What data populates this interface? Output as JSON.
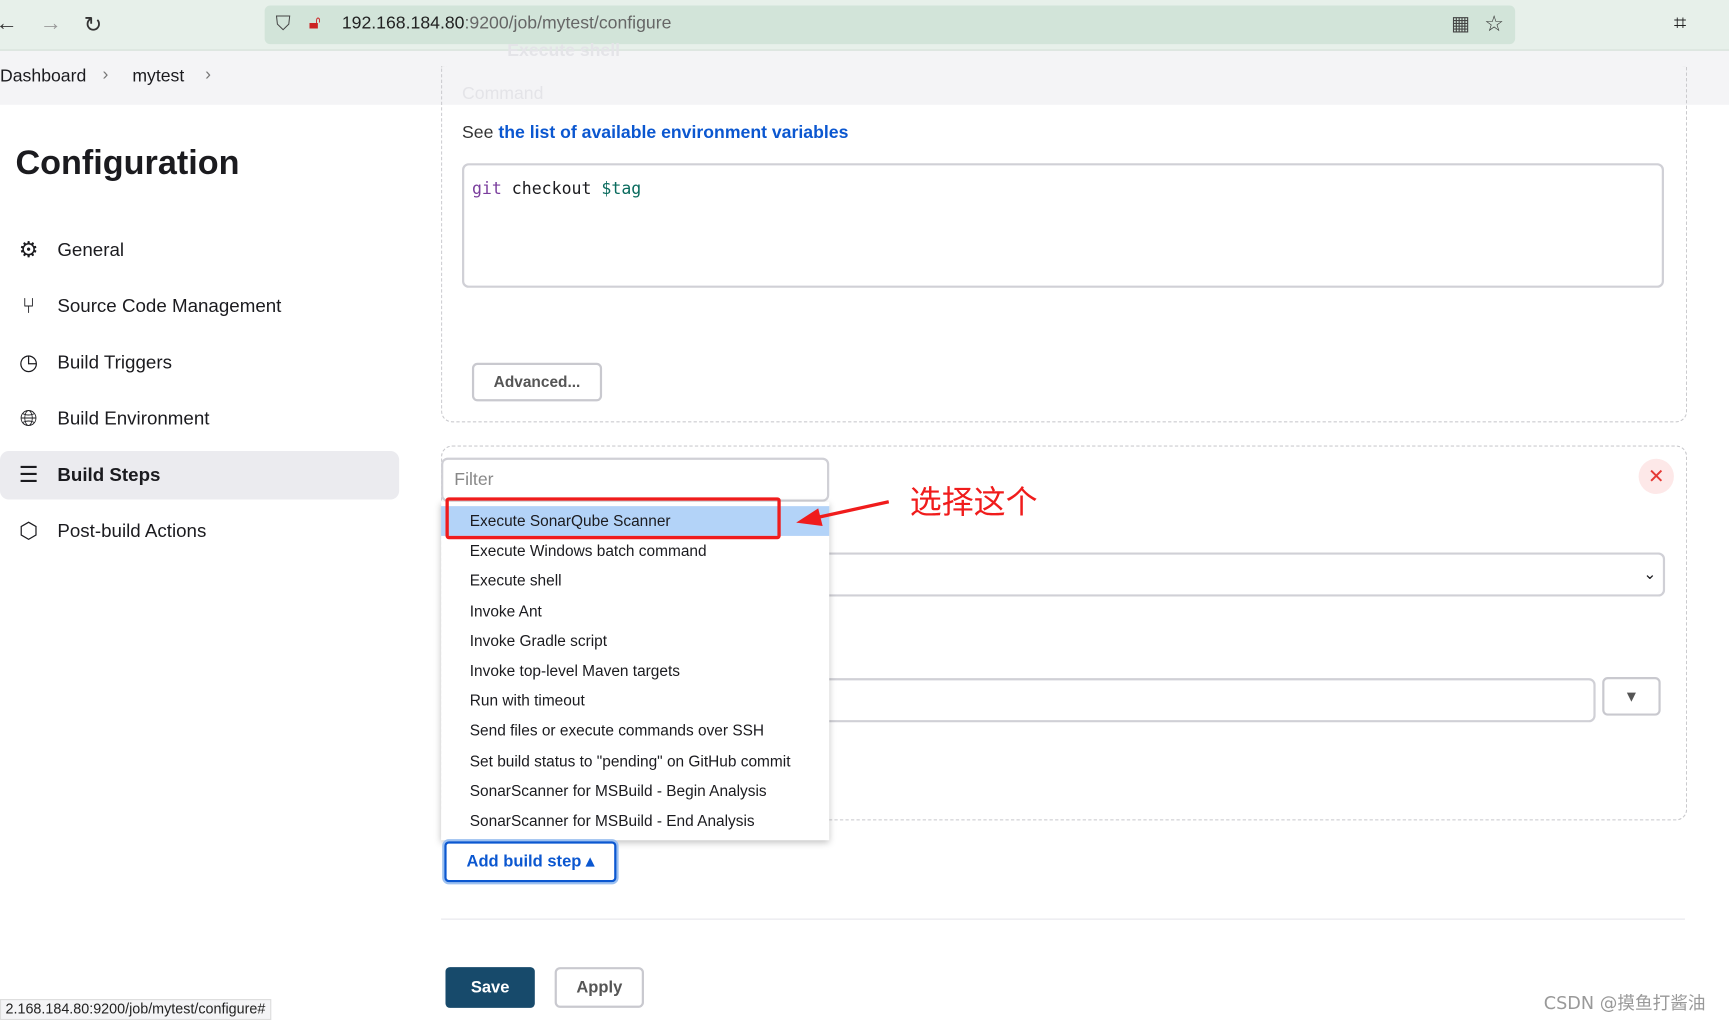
{
  "browser": {
    "url_host": "192.168.184.80",
    "url_rest": ":9200/job/mytest/configure",
    "icons": [
      "back-arrow",
      "forward-arrow",
      "reload",
      "shield",
      "insecure-lock",
      "qr-code",
      "star",
      "crop"
    ]
  },
  "breadcrumb": [
    {
      "label": "Dashboard"
    },
    {
      "label": "mytest"
    }
  ],
  "sidebar": {
    "title": "Configuration",
    "items": [
      {
        "label": "General",
        "icon": "gear-icon"
      },
      {
        "label": "Source Code Management",
        "icon": "branch-icon"
      },
      {
        "label": "Build Triggers",
        "icon": "clock-icon"
      },
      {
        "label": "Build Environment",
        "icon": "globe-icon"
      },
      {
        "label": "Build Steps",
        "icon": "list-icon",
        "active": true
      },
      {
        "label": "Post-build Actions",
        "icon": "package-icon"
      }
    ]
  },
  "main": {
    "faded_step_title": "Execute shell",
    "command_label": "Command",
    "see_prefix": "See ",
    "env_link": "the list of available environment variables",
    "command": {
      "kw": "git",
      "mid": " checkout ",
      "var": "$tag"
    },
    "advanced_label": "Advanced...",
    "filter_placeholder": "Filter",
    "menu_items": [
      "Execute SonarQube Scanner",
      "Execute Windows batch command",
      "Execute shell",
      "Invoke Ant",
      "Invoke Gradle script",
      "Invoke top-level Maven targets",
      "Run with timeout",
      "Send files or execute commands over SSH",
      "Set build status to \"pending\" on GitHub commit",
      "SonarScanner for MSBuild - Begin Analysis",
      "SonarScanner for MSBuild - End Analysis"
    ],
    "selected_item": "Execute SonarQube Scanner",
    "annotation": "选择这个",
    "add_build_step": "Add build step ▴",
    "close_symbol": "✕"
  },
  "footer": {
    "save": "Save",
    "apply": "Apply"
  },
  "status_url": "2.168.184.80:9200/job/mytest/configure#",
  "watermark": "CSDN @摸鱼打酱油",
  "colors": {
    "accent": "#0b57d0",
    "save": "#174a6b",
    "highlight": "#b3d3f8",
    "annotation": "#f01c1c"
  }
}
